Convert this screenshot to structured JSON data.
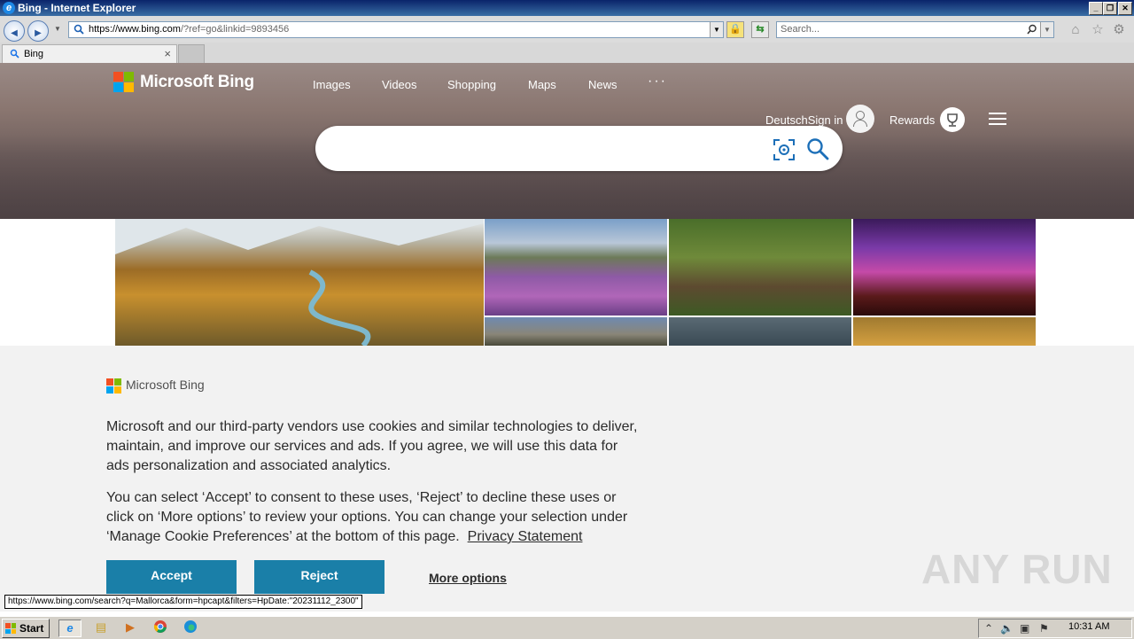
{
  "window": {
    "title": "Bing - Internet Explorer",
    "min_label": "_",
    "restore_label": "❐",
    "close_label": "✕"
  },
  "navbar": {
    "back_glyph": "◀",
    "forward_glyph": "▶",
    "address_host": "https://www.bing.com",
    "address_rest": "/?ref=go&linkid=9893456",
    "search_placeholder": "Search..."
  },
  "tabs": [
    {
      "label": "Bing"
    }
  ],
  "bing": {
    "logo_text": "Microsoft Bing",
    "nav": [
      "Images",
      "Videos",
      "Shopping",
      "Maps",
      "News"
    ],
    "more_dots": "···",
    "language": "Deutsch",
    "sign_in": "Sign in",
    "rewards": "Rewards",
    "colors": {
      "red": "#f25022",
      "green": "#7fba00",
      "blue": "#00a4ef",
      "yellow": "#ffb900"
    }
  },
  "cookie": {
    "logo_text": "Microsoft Bing",
    "paragraph1": "Microsoft and our third-party vendors use cookies and similar technologies to deliver, maintain, and improve our services and ads. If you agree, we will use this data for ads personalization and associated analytics.",
    "paragraph2": "You can select ‘Accept’ to consent to these uses, ‘Reject’ to decline these uses or click on ‘More options’ to review your options. You can change your selection under ‘Manage Cookie Preferences’ at the bottom of this page.",
    "privacy_link": "Privacy Statement",
    "accept_label": "Accept",
    "reject_label": "Reject",
    "more_label": "More options"
  },
  "status_url": "https://www.bing.com/search?q=Mallorca&form=hpcapt&filters=HpDate:\"20231112_2300\"",
  "watermark": "ANY RUN",
  "taskbar": {
    "start_label": "Start",
    "clock": "10:31 AM"
  }
}
